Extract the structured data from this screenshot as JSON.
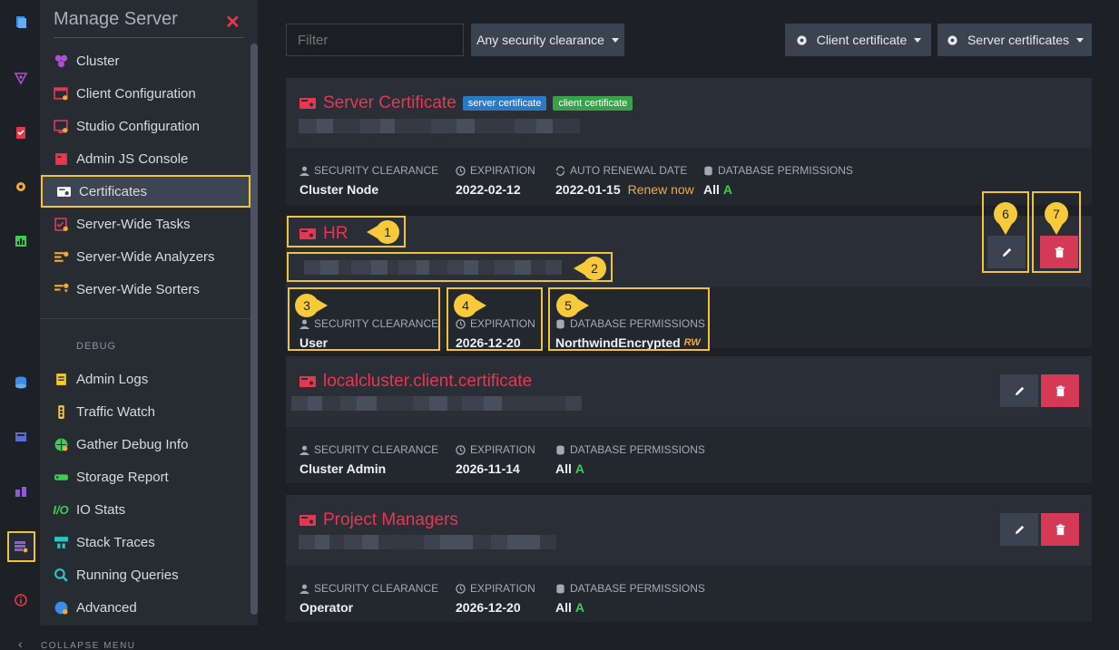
{
  "menu": {
    "title": "Manage Server",
    "items": [
      {
        "label": "Cluster",
        "icon": "cluster-icon"
      },
      {
        "label": "Client Configuration",
        "icon": "client-configuration-icon"
      },
      {
        "label": "Studio Configuration",
        "icon": "studio-configuration-icon"
      },
      {
        "label": "Admin JS Console",
        "icon": "admin-js-console-icon"
      },
      {
        "label": "Certificates",
        "icon": "certificates-icon"
      },
      {
        "label": "Server-Wide Tasks",
        "icon": "server-wide-tasks-icon"
      },
      {
        "label": "Server-Wide Analyzers",
        "icon": "server-wide-analyzers-icon"
      },
      {
        "label": "Server-Wide Sorters",
        "icon": "server-wide-sorters-icon"
      }
    ],
    "debug_header": "DEBUG",
    "debug_items": [
      {
        "label": "Admin Logs",
        "icon": "admin-logs-icon"
      },
      {
        "label": "Traffic Watch",
        "icon": "traffic-watch-icon"
      },
      {
        "label": "Gather Debug Info",
        "icon": "gather-debug-info-icon"
      },
      {
        "label": "Storage Report",
        "icon": "storage-report-icon"
      },
      {
        "label": "IO Stats",
        "icon": "io-stats-icon"
      },
      {
        "label": "Stack Traces",
        "icon": "stack-traces-icon"
      },
      {
        "label": "Running Queries",
        "icon": "running-queries-icon"
      },
      {
        "label": "Advanced",
        "icon": "advanced-icon"
      }
    ],
    "collapse_label": "COLLAPSE MENU"
  },
  "toolbar": {
    "filter_placeholder": "Filter",
    "clearance_label": "Any security clearance",
    "client_cert_label": "Client certificate",
    "server_certs_label": "Server certificates"
  },
  "labels": {
    "security_clearance": "SECURITY CLEARANCE",
    "expiration": "EXPIRATION",
    "auto_renewal": "AUTO RENEWAL DATE",
    "db_permissions": "DATABASE PERMISSIONS"
  },
  "certificates": [
    {
      "name": "Server Certificate",
      "badges": [
        "server certificate",
        "client certificate"
      ],
      "clearance": "Cluster Node",
      "expiration": "2022-02-12",
      "renewal_date": "2022-01-15",
      "renew_link": "Renew now",
      "permissions": "All",
      "permission_level": "A"
    },
    {
      "name": "HR",
      "clearance": "User",
      "expiration": "2026-12-20",
      "permissions": "NorthwindEncrypted",
      "permission_level": "RW"
    },
    {
      "name": "localcluster.client.certificate",
      "clearance": "Cluster Admin",
      "expiration": "2026-11-14",
      "permissions": "All",
      "permission_level": "A"
    },
    {
      "name": "Project Managers",
      "clearance": "Operator",
      "expiration": "2026-12-20",
      "permissions": "All",
      "permission_level": "A"
    }
  ],
  "markers": [
    "1",
    "2",
    "3",
    "4",
    "5",
    "6",
    "7"
  ],
  "colors": {
    "accent_red": "#e5384f",
    "highlight": "#f0c43a",
    "delete": "#d43a55"
  }
}
